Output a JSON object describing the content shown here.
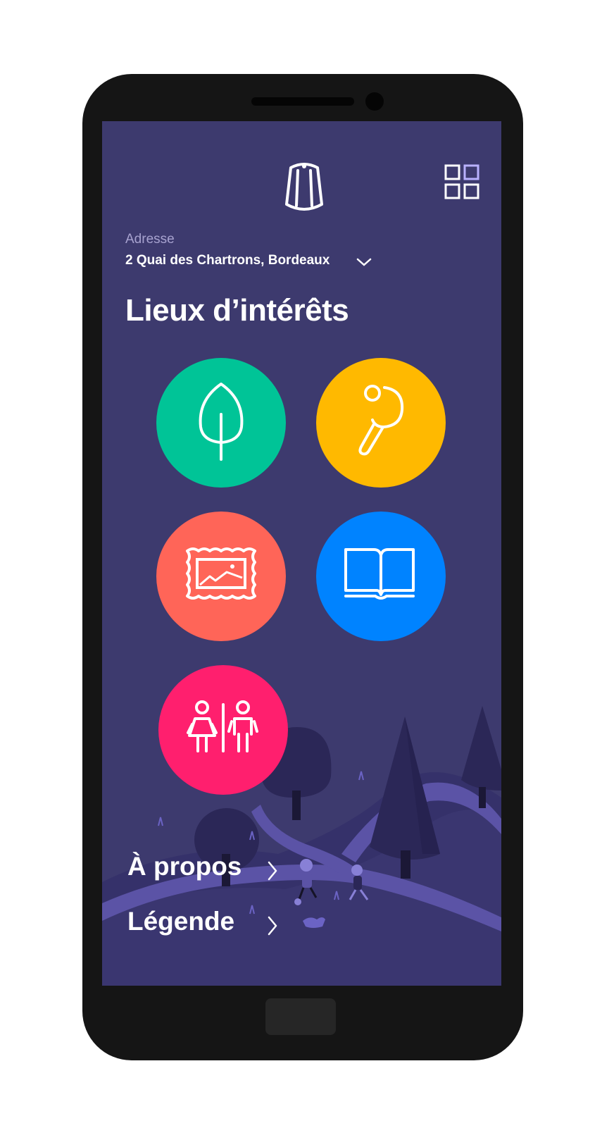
{
  "colors": {
    "phone_body": "#151515",
    "screen_background": "#3d3a6e",
    "nature": "#00c497",
    "sport": "#ffb900",
    "culture": "#ff6558",
    "library": "#0083ff",
    "toilets": "#ff1f6e"
  },
  "header": {
    "logo_icon": "canele-icon",
    "menu_icon": "grid-icon"
  },
  "address": {
    "label": "Adresse",
    "value": "2 Quai des Chartrons, Bordeaux"
  },
  "points_of_interest": {
    "title": "Lieux d’intérêts",
    "categories": [
      {
        "icon": "tree-icon",
        "color": "#00c497"
      },
      {
        "icon": "ping-pong-icon",
        "color": "#ffb900"
      },
      {
        "icon": "painting-icon",
        "color": "#ff6558"
      },
      {
        "icon": "book-icon",
        "color": "#0083ff"
      },
      {
        "icon": "toilets-icon",
        "color": "#ff1f6e"
      }
    ]
  },
  "menu": {
    "about": "À propos",
    "legend": "Légende"
  }
}
